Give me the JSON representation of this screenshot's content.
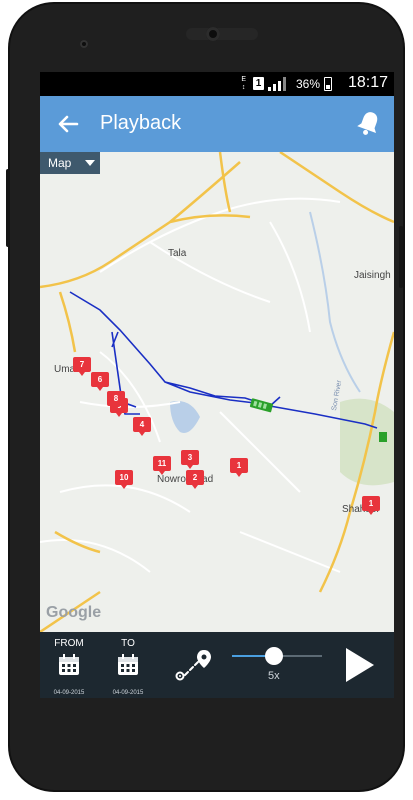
{
  "status": {
    "network_label": "E",
    "sim_label": "1",
    "battery_percent": "36%",
    "time": "18:17"
  },
  "appbar": {
    "title": "Playback",
    "back_icon": "arrow-left-icon",
    "alert_icon": "bell-icon"
  },
  "map": {
    "type_selector": "Map",
    "places": {
      "tala": "Tala",
      "jaisingh": "Jaisingh",
      "umaria": "Umaria",
      "nowrozabad": "Nowrozabad",
      "shahdol": "Shahdol",
      "river": "Son River"
    },
    "markers": [
      "1",
      "1",
      "2",
      "3",
      "4",
      "5",
      "6",
      "7",
      "8",
      "10",
      "11"
    ],
    "attribution": "Google",
    "colors": {
      "route": "#1a2fc4",
      "marker": "#e8343c",
      "vehicle": "#2aa02a",
      "road": "#f2c34a"
    }
  },
  "controls": {
    "from_label": "FROM",
    "to_label": "TO",
    "from_date": "04-09-2015",
    "to_date": "04-09-2015",
    "speed_label": "5x",
    "speed_position": 0.47,
    "route_icon": "route-icon",
    "calendar_icon": "calendar-icon",
    "play_icon": "play-icon"
  }
}
